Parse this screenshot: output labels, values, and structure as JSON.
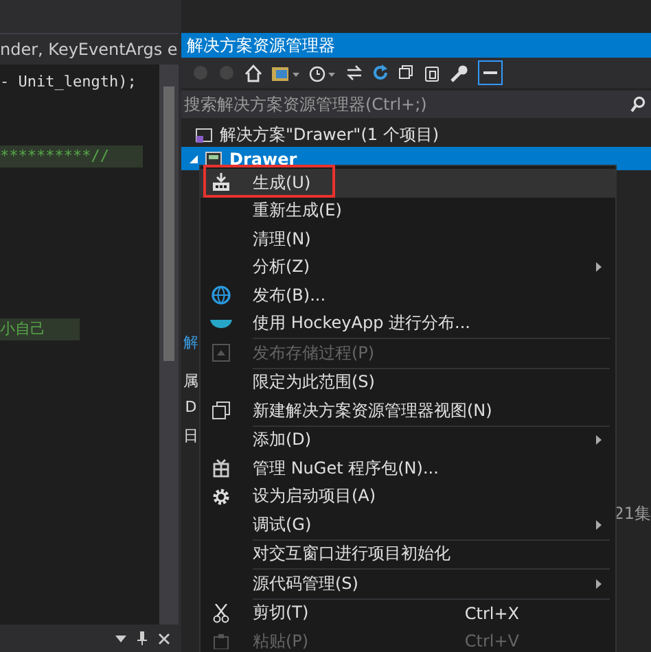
{
  "editor": {
    "member_dropdown": "nder, KeyEventArgs e",
    "code_lines": [
      {
        "text": "- Unit_length);",
        "kind": "code"
      },
      {
        "text": "**********//",
        "kind": "comment"
      },
      {
        "text": "小自己",
        "kind": "comment"
      }
    ]
  },
  "explorer": {
    "title": "解决方案资源管理器",
    "search": {
      "placeholder": "搜索解决方案资源管理器(Ctrl+;)"
    },
    "tree": [
      {
        "label": "解决方案\"Drawer\"(1 个项目)",
        "selected": false,
        "children": [
          {
            "label": "Drawer",
            "selected": true
          }
        ]
      }
    ],
    "side_tabs": [
      "解",
      "属",
      "D",
      "日"
    ],
    "partial_text": "21集"
  },
  "context_menu": [
    {
      "kind": "item",
      "label": "生成(U)",
      "selected": true,
      "disabled": false,
      "submenu": false
    },
    {
      "kind": "item",
      "label": "重新生成(E)",
      "selected": false,
      "disabled": false,
      "submenu": false
    },
    {
      "kind": "item",
      "label": "清理(N)",
      "selected": false,
      "disabled": false,
      "submenu": false
    },
    {
      "kind": "item",
      "label": "分析(Z)",
      "selected": false,
      "disabled": false,
      "submenu": true
    },
    {
      "kind": "item",
      "label": "发布(B)...",
      "selected": false,
      "disabled": false,
      "submenu": false
    },
    {
      "kind": "item",
      "label": "使用 HockeyApp 进行分布...",
      "selected": false,
      "disabled": false,
      "submenu": false
    },
    {
      "kind": "separator"
    },
    {
      "kind": "item",
      "label": "发布存储过程(P)",
      "selected": false,
      "disabled": true,
      "submenu": false
    },
    {
      "kind": "separator"
    },
    {
      "kind": "item",
      "label": "限定为此范围(S)",
      "selected": false,
      "disabled": false,
      "submenu": false
    },
    {
      "kind": "item",
      "label": "新建解决方案资源管理器视图(N)",
      "selected": false,
      "disabled": false,
      "submenu": false
    },
    {
      "kind": "separator"
    },
    {
      "kind": "item",
      "label": "添加(D)",
      "selected": false,
      "disabled": false,
      "submenu": true
    },
    {
      "kind": "item",
      "label": "管理 NuGet 程序包(N)...",
      "selected": false,
      "disabled": false,
      "submenu": false
    },
    {
      "kind": "item",
      "label": "设为启动项目(A)",
      "selected": false,
      "disabled": false,
      "submenu": false
    },
    {
      "kind": "item",
      "label": "调试(G)",
      "selected": false,
      "disabled": false,
      "submenu": true
    },
    {
      "kind": "separator"
    },
    {
      "kind": "item",
      "label": "对交互窗口进行项目初始化",
      "selected": false,
      "disabled": false,
      "submenu": false
    },
    {
      "kind": "separator"
    },
    {
      "kind": "item",
      "label": "源代码管理(S)",
      "selected": false,
      "disabled": false,
      "submenu": true
    },
    {
      "kind": "separator"
    },
    {
      "kind": "item",
      "label": "剪切(T)",
      "shortcut": "Ctrl+X",
      "selected": false,
      "disabled": false,
      "submenu": false
    },
    {
      "kind": "item",
      "label": "粘贴(P)",
      "shortcut": "Ctrl+V",
      "selected": false,
      "disabled": true,
      "submenu": false
    }
  ]
}
